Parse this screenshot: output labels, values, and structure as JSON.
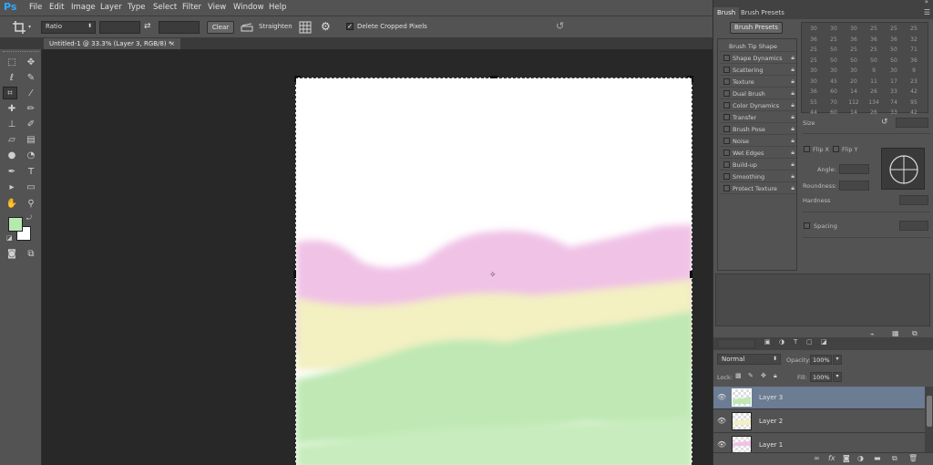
{
  "app": {
    "logo": "Ps",
    "menu": [
      "File",
      "Edit",
      "Image",
      "Layer",
      "Type",
      "Select",
      "Filter",
      "View",
      "Window",
      "Help"
    ],
    "window_controls": [
      "–",
      "□",
      "×"
    ]
  },
  "options_bar": {
    "ratio_select": "Ratio",
    "clear_label": "Clear",
    "straighten_label": "Straighten",
    "delete_cropped_label": "Delete Cropped Pixels",
    "delete_cropped_checked": true
  },
  "document": {
    "tab_title": "Untitled-1 @ 33.3% (Layer 3, RGB/8) *",
    "tab_close": "×"
  },
  "colors": {
    "foreground": "#b7e8b0",
    "background": "#ffffff",
    "pink": "#f0c2e6",
    "yellow": "#f3f0c2",
    "green": "#bfe8b4",
    "accent_selected_layer": "#6b7c93"
  },
  "brush_panel": {
    "tabs": [
      "Brush",
      "Brush Presets"
    ],
    "presets_button": "Brush Presets",
    "options": [
      {
        "label": "Brush Tip Shape",
        "checkbox": false,
        "lock": false
      },
      {
        "label": "Shape Dynamics",
        "checkbox": true,
        "lock": true
      },
      {
        "label": "Scattering",
        "checkbox": true,
        "lock": true
      },
      {
        "label": "Texture",
        "checkbox": true,
        "lock": true
      },
      {
        "label": "Dual Brush",
        "checkbox": true,
        "lock": true
      },
      {
        "label": "Color Dynamics",
        "checkbox": true,
        "lock": true
      },
      {
        "label": "Transfer",
        "checkbox": true,
        "lock": true
      },
      {
        "label": "Brush Pose",
        "checkbox": true,
        "lock": true
      },
      {
        "label": "Noise",
        "checkbox": true,
        "lock": true
      },
      {
        "label": "Wet Edges",
        "checkbox": true,
        "lock": true
      },
      {
        "label": "Build-up",
        "checkbox": true,
        "lock": true
      },
      {
        "label": "Smoothing",
        "checkbox": true,
        "lock": true
      },
      {
        "label": "Protect Texture",
        "checkbox": true,
        "lock": true
      }
    ],
    "tip_sizes": [
      "30",
      "30",
      "30",
      "25",
      "25",
      "25",
      "36",
      "25",
      "36",
      "36",
      "36",
      "32",
      "25",
      "50",
      "25",
      "25",
      "50",
      "71",
      "25",
      "50",
      "50",
      "50",
      "50",
      "36",
      "30",
      "30",
      "30",
      "9",
      "30",
      "9",
      "30",
      "45",
      "20",
      "11",
      "17",
      "23",
      "36",
      "60",
      "14",
      "26",
      "33",
      "42",
      "55",
      "70",
      "112",
      "134",
      "74",
      "95",
      "44",
      "60",
      "14",
      "26",
      "33",
      "42"
    ],
    "size_label": "Size",
    "flip_x": "Flip X",
    "flip_y": "Flip Y",
    "angle_label": "Angle:",
    "roundness_label": "Roundness:",
    "hardness_label": "Hardness",
    "spacing_label": "Spacing"
  },
  "layers_panel": {
    "blend_mode": "Normal",
    "opacity_label": "Opacity:",
    "opacity_value": "100%",
    "lock_label": "Lock:",
    "fill_label": "Fill:",
    "fill_value": "100%",
    "layers": [
      {
        "name": "Layer 3",
        "selected": true
      },
      {
        "name": "Layer 2",
        "selected": false
      },
      {
        "name": "Layer 1",
        "selected": false
      }
    ]
  }
}
